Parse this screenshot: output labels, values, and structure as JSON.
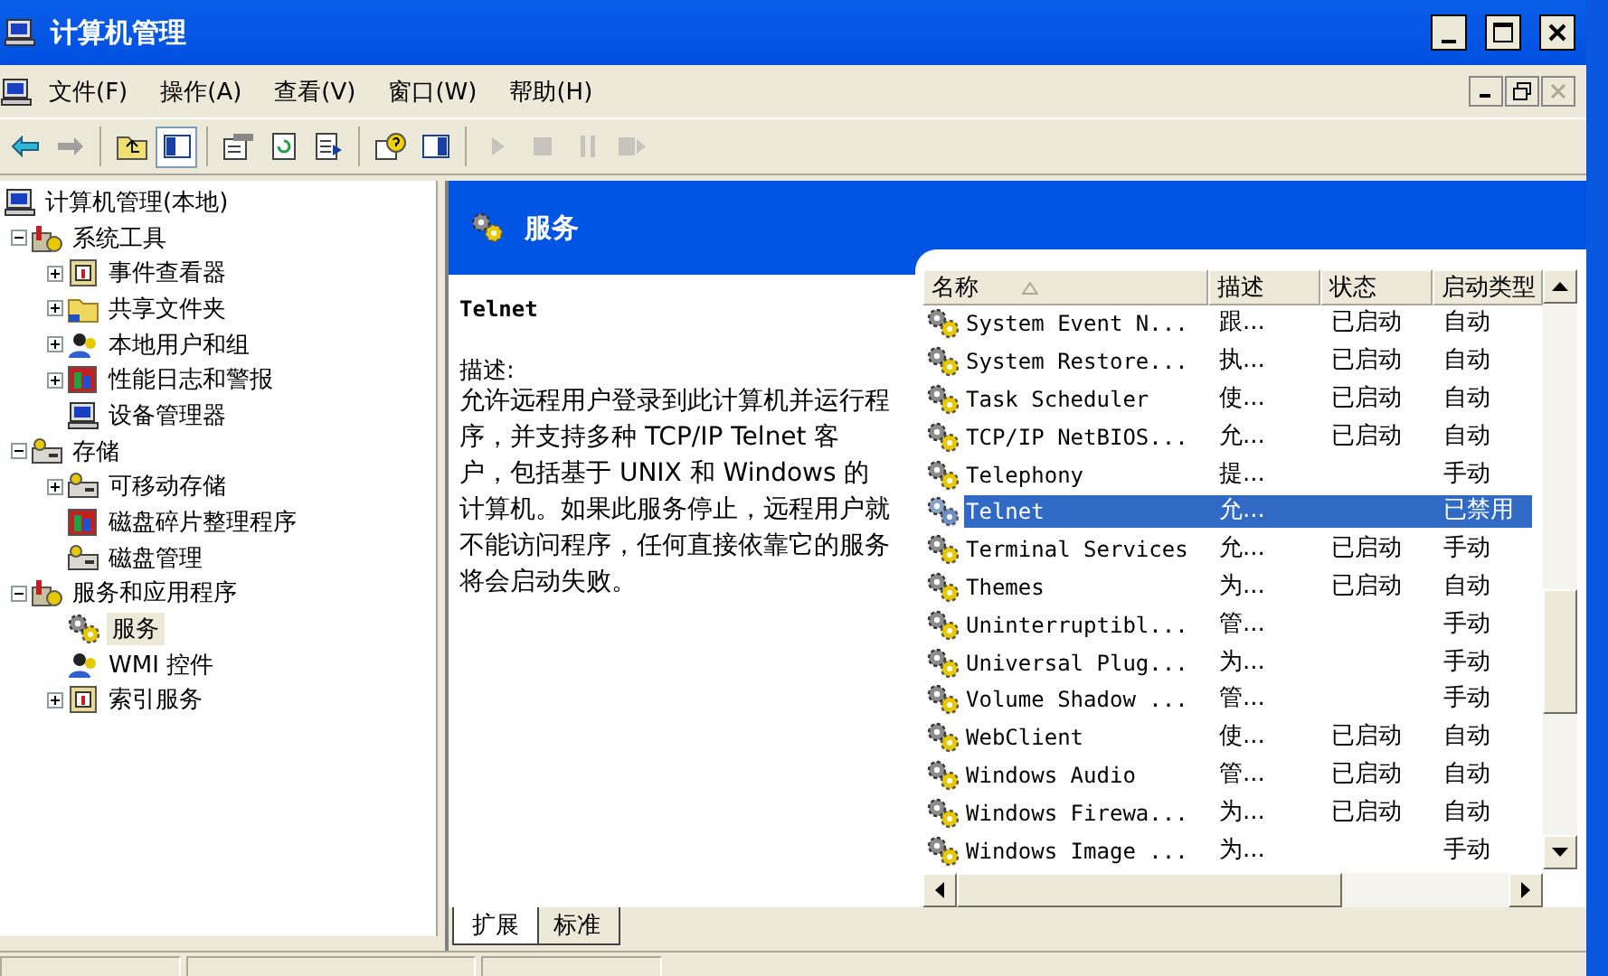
{
  "window": {
    "title": "计算机管理"
  },
  "menu": [
    "文件(F)",
    "操作(A)",
    "查看(V)",
    "窗口(W)",
    "帮助(H)"
  ],
  "toolbar": [
    {
      "kind": "back",
      "disabled": false,
      "pressed": false
    },
    {
      "kind": "forward",
      "disabled": false,
      "pressed": false
    },
    {
      "kind": "up",
      "disabled": false,
      "pressed": false
    },
    {
      "kind": "tree",
      "disabled": false,
      "pressed": true
    },
    {
      "kind": "properties",
      "disabled": false,
      "pressed": false
    },
    {
      "kind": "refresh",
      "disabled": false,
      "pressed": false
    },
    {
      "kind": "export",
      "disabled": false,
      "pressed": false
    },
    {
      "kind": "help",
      "disabled": false,
      "pressed": false
    },
    {
      "kind": "pane",
      "disabled": false,
      "pressed": false
    },
    {
      "kind": "play",
      "disabled": true,
      "pressed": false
    },
    {
      "kind": "stop",
      "disabled": true,
      "pressed": false
    },
    {
      "kind": "pause",
      "disabled": true,
      "pressed": false
    },
    {
      "kind": "restart",
      "disabled": true,
      "pressed": false
    }
  ],
  "tree": [
    {
      "label": "计算机管理(本地)",
      "kind": "computer",
      "selected": false,
      "children": [
        {
          "label": "系统工具",
          "kind": "tools",
          "expanded": true,
          "selected": false,
          "children": [
            {
              "label": "事件查看器",
              "kind": "viewer",
              "expanded": false,
              "selected": false
            },
            {
              "label": "共享文件夹",
              "kind": "folder",
              "expanded": false,
              "selected": false
            },
            {
              "label": "本地用户和组",
              "kind": "users",
              "expanded": false,
              "selected": false
            },
            {
              "label": "性能日志和警报",
              "kind": "chart",
              "expanded": false,
              "selected": false
            },
            {
              "label": "设备管理器",
              "kind": "computer",
              "selected": false
            }
          ]
        },
        {
          "label": "存储",
          "kind": "storage",
          "expanded": true,
          "selected": false,
          "children": [
            {
              "label": "可移动存储",
              "kind": "storage",
              "expanded": false,
              "selected": false
            },
            {
              "label": "磁盘碎片整理程序",
              "kind": "chart",
              "selected": false
            },
            {
              "label": "磁盘管理",
              "kind": "storage",
              "selected": false
            }
          ]
        },
        {
          "label": "服务和应用程序",
          "kind": "tools",
          "expanded": true,
          "selected": false,
          "children": [
            {
              "label": "服务",
              "kind": "gear",
              "selected": true
            },
            {
              "label": "WMI 控件",
              "kind": "users",
              "selected": false
            },
            {
              "label": "索引服务",
              "kind": "viewer",
              "expanded": false,
              "selected": false
            }
          ]
        }
      ]
    }
  ],
  "panel": {
    "title": "服务",
    "service_name": "Telnet",
    "description_label": "描述:",
    "description": "允许远程用户登录到此计算机并运行程序，并支持多种 TCP/IP Telnet 客户，包括基于 UNIX 和 Windows 的计算机。如果此服务停止，远程用户就不能访问程序，任何直接依靠它的服务将会启动失败。"
  },
  "table": {
    "columns": [
      "名称",
      "描述",
      "状态",
      "启动类型"
    ],
    "rows": [
      {
        "name": "System Event N...",
        "description": "跟...",
        "status": "已启动",
        "startup": "自动",
        "selected": false
      },
      {
        "name": "System Restore...",
        "description": "执...",
        "status": "已启动",
        "startup": "自动",
        "selected": false
      },
      {
        "name": "Task Scheduler",
        "description": "使...",
        "status": "已启动",
        "startup": "自动",
        "selected": false
      },
      {
        "name": "TCP/IP NetBIOS...",
        "description": "允...",
        "status": "已启动",
        "startup": "自动",
        "selected": false
      },
      {
        "name": "Telephony",
        "description": "提...",
        "startup": "手动",
        "selected": false
      },
      {
        "name": "Telnet",
        "description": "允...",
        "startup": "已禁用",
        "selected": true
      },
      {
        "name": "Terminal Services",
        "description": "允...",
        "status": "已启动",
        "startup": "手动",
        "selected": false
      },
      {
        "name": "Themes",
        "description": "为...",
        "status": "已启动",
        "startup": "自动",
        "selected": false
      },
      {
        "name": "Uninterruptibl...",
        "description": "管...",
        "startup": "手动",
        "selected": false
      },
      {
        "name": "Universal Plug...",
        "description": "为...",
        "startup": "手动",
        "selected": false
      },
      {
        "name": "Volume Shadow ...",
        "description": "管...",
        "startup": "手动",
        "selected": false
      },
      {
        "name": "WebClient",
        "description": "使...",
        "status": "已启动",
        "startup": "自动",
        "selected": false
      },
      {
        "name": "Windows Audio",
        "description": "管...",
        "status": "已启动",
        "startup": "自动",
        "selected": false
      },
      {
        "name": "Windows Firewa...",
        "description": "为...",
        "status": "已启动",
        "startup": "自动",
        "selected": false
      },
      {
        "name": "Windows Image ...",
        "description": "为...",
        "startup": "手动",
        "selected": false
      }
    ]
  },
  "view_tabs": [
    {
      "label": "扩展",
      "selected": true
    },
    {
      "label": "标准",
      "selected": false
    }
  ]
}
